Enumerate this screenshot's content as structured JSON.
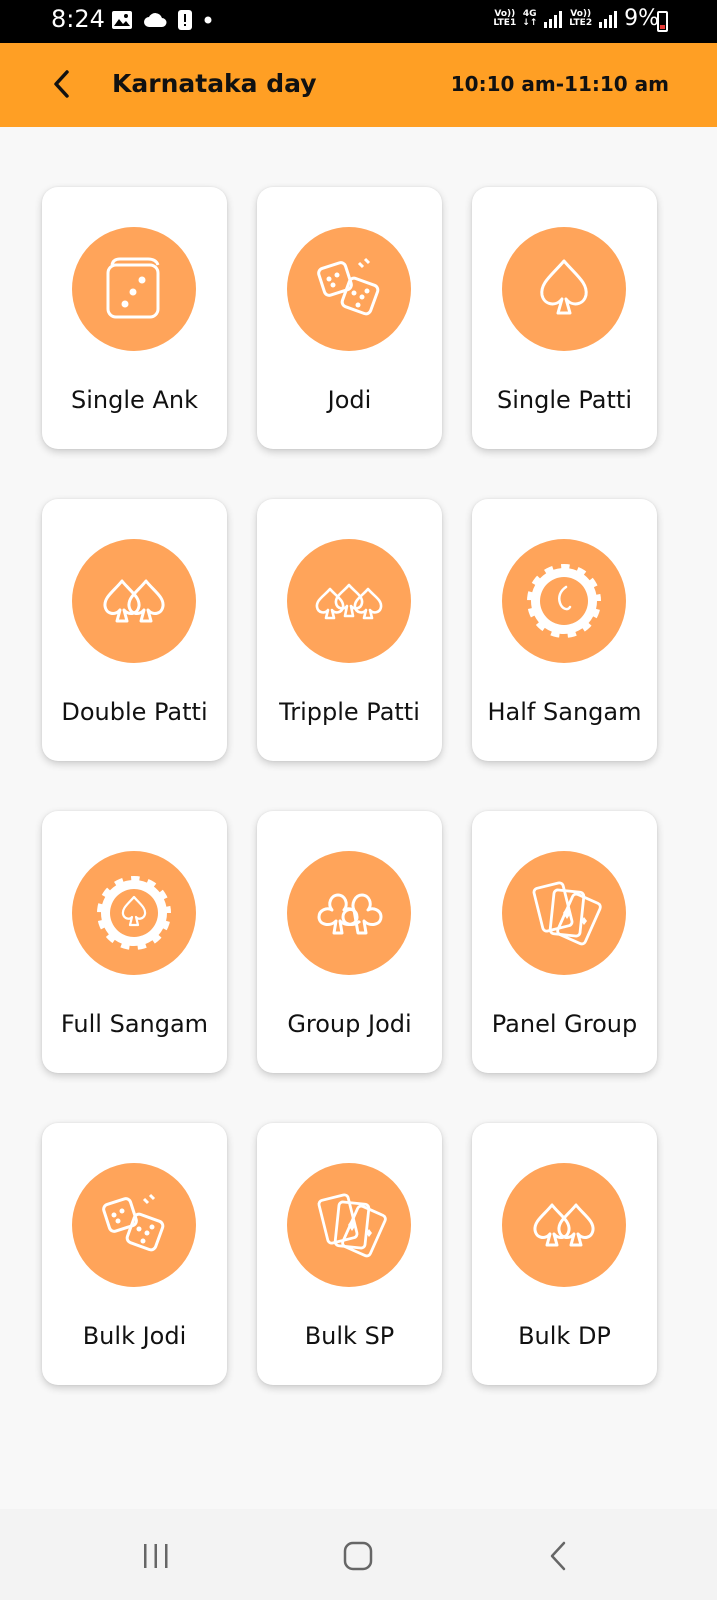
{
  "status_bar": {
    "time": "8:24",
    "sim1_top": "Vo))",
    "sim1_bottom": "LTE1",
    "network": "4G",
    "sim2_top": "Vo))",
    "sim2_bottom": "LTE2",
    "battery": "9%",
    "battery_color": "#e53935"
  },
  "app_bar": {
    "title": "Karnataka day",
    "time_range": "10:10 am-11:10 am",
    "color": "#ff9f24"
  },
  "games": [
    {
      "label": "Single Ank",
      "icon": "single-die-icon"
    },
    {
      "label": "Jodi",
      "icon": "dice-pair-icon"
    },
    {
      "label": "Single Patti",
      "icon": "spade-icon"
    },
    {
      "label": "Double Patti",
      "icon": "double-spade-icon"
    },
    {
      "label": "Tripple Patti",
      "icon": "triple-spade-icon"
    },
    {
      "label": "Half Sangam",
      "icon": "poker-chip-icon"
    },
    {
      "label": "Full Sangam",
      "icon": "poker-chip-spade-icon"
    },
    {
      "label": "Group Jodi",
      "icon": "double-club-icon"
    },
    {
      "label": "Panel Group",
      "icon": "playing-cards-icon"
    },
    {
      "label": "Bulk Jodi",
      "icon": "dice-pair-icon"
    },
    {
      "label": "Bulk SP",
      "icon": "playing-cards-icon"
    },
    {
      "label": "Bulk DP",
      "icon": "double-spade-icon"
    }
  ],
  "accent_color": "#ffa45a"
}
